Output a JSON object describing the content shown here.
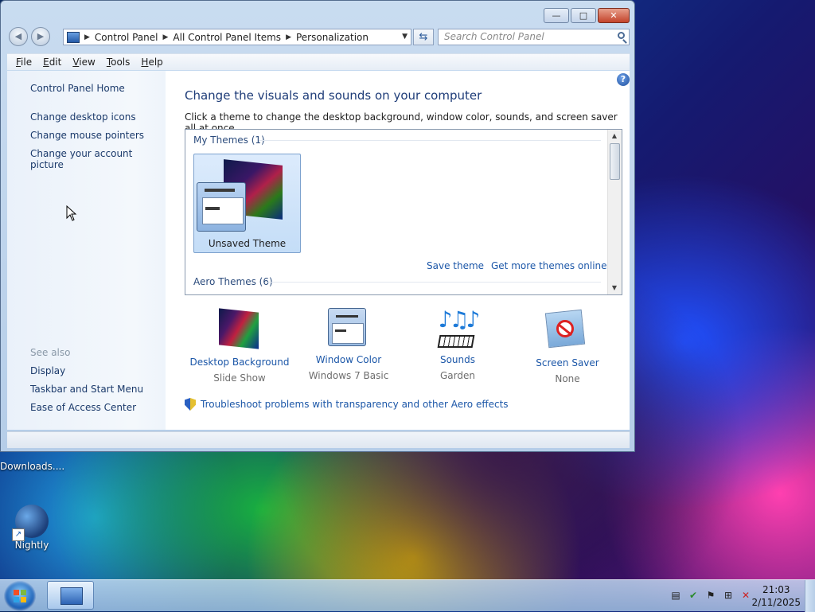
{
  "desktop": {
    "icons": [
      {
        "label": "Downloads...."
      },
      {
        "label": "Nightly"
      }
    ]
  },
  "window": {
    "caption_buttons": {
      "minimize": "—",
      "maximize": "□",
      "close": "✕"
    },
    "address": {
      "crumbs": [
        "Control Panel",
        "All Control Panel Items",
        "Personalization"
      ]
    },
    "search": {
      "placeholder": "Search Control Panel"
    },
    "menu": [
      "File",
      "Edit",
      "View",
      "Tools",
      "Help"
    ],
    "left_pane": {
      "home": "Control Panel Home",
      "links": [
        "Change desktop icons",
        "Change mouse pointers",
        "Change your account picture"
      ],
      "see_also_label": "See also",
      "see_also": [
        "Display",
        "Taskbar and Start Menu",
        "Ease of Access Center"
      ]
    },
    "main": {
      "title": "Change the visuals and sounds on your computer",
      "description": "Click a theme to change the desktop background, window color, sounds, and screen saver all at once.",
      "my_themes_header": "My Themes (1)",
      "theme_name": "Unsaved Theme",
      "save_theme": "Save theme",
      "get_more": "Get more themes online",
      "aero_header": "Aero Themes (6)",
      "options": [
        {
          "label": "Desktop Background",
          "value": "Slide Show",
          "icon": "desktop-background-icon"
        },
        {
          "label": "Window Color",
          "value": "Windows 7 Basic",
          "icon": "window-color-icon"
        },
        {
          "label": "Sounds",
          "value": "Garden",
          "icon": "sounds-icon"
        },
        {
          "label": "Screen Saver",
          "value": "None",
          "icon": "screen-saver-icon"
        }
      ],
      "troubleshoot": "Troubleshoot problems with transparency and other Aero effects"
    }
  },
  "taskbar": {
    "time": "21:03",
    "date": "2/11/2025"
  },
  "colors": {
    "link": "#1c57a8",
    "title": "#1e3c78",
    "close_button": "#c3432b"
  }
}
